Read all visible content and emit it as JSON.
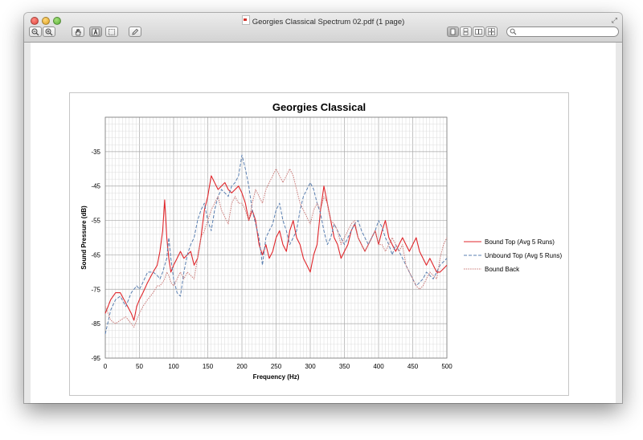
{
  "window": {
    "title": "Georgies Classical Spectrum 02.pdf (1 page)"
  },
  "toolbar": {
    "buttons": [
      "zoom-out-icon",
      "zoom-in-icon",
      "hand-tool-icon",
      "text-select-icon",
      "select-rect-icon",
      "annotate-pencil-icon"
    ],
    "view_buttons": [
      "single-page-icon",
      "continuous-icon",
      "two-page-icon",
      "two-up-continuous-icon"
    ],
    "search_placeholder": ""
  },
  "chart_data": {
    "type": "line",
    "title": "Georgies Classical",
    "xlabel": "Frequency (Hz)",
    "ylabel": "Sound Pressure (dB)",
    "xlim": [
      0,
      500
    ],
    "ylim": [
      -95,
      -25
    ],
    "xticks": [
      "0",
      "50",
      "100",
      "150",
      "200",
      "250",
      "300",
      "350",
      "400",
      "450",
      "500"
    ],
    "yticks": [
      "-35",
      "-45",
      "-55",
      "-65",
      "-75",
      "-85",
      "-95"
    ],
    "grid": true,
    "legend_position": "right",
    "series": [
      {
        "name": "Bound Top (Avg 5 Runs)",
        "color": "#e0262b",
        "dash": "solid",
        "x": [
          0,
          8,
          15,
          22,
          30,
          38,
          42,
          46,
          50,
          55,
          62,
          70,
          76,
          80,
          84,
          87,
          90,
          93,
          96,
          100,
          105,
          110,
          115,
          120,
          125,
          130,
          135,
          140,
          145,
          150,
          155,
          160,
          165,
          170,
          175,
          180,
          185,
          190,
          195,
          200,
          205,
          210,
          215,
          220,
          225,
          230,
          235,
          240,
          245,
          250,
          255,
          260,
          265,
          270,
          275,
          280,
          285,
          290,
          295,
          300,
          305,
          310,
          315,
          320,
          325,
          330,
          335,
          340,
          345,
          350,
          355,
          360,
          365,
          370,
          375,
          380,
          385,
          390,
          395,
          400,
          405,
          410,
          415,
          420,
          425,
          430,
          435,
          440,
          445,
          450,
          455,
          460,
          465,
          470,
          475,
          480,
          485,
          490,
          495,
          500
        ],
        "y": [
          -82,
          -78,
          -76,
          -76,
          -79,
          -82,
          -84,
          -80,
          -78,
          -76,
          -73,
          -70,
          -68,
          -64,
          -58,
          -49,
          -60,
          -66,
          -70,
          -68,
          -66,
          -64,
          -66,
          -65,
          -64,
          -68,
          -66,
          -60,
          -52,
          -48,
          -42,
          -44,
          -46,
          -45,
          -44,
          -46,
          -47,
          -46,
          -45,
          -47,
          -50,
          -55,
          -52,
          -55,
          -62,
          -65,
          -62,
          -66,
          -64,
          -60,
          -58,
          -62,
          -64,
          -58,
          -55,
          -60,
          -62,
          -66,
          -68,
          -70,
          -65,
          -62,
          -52,
          -45,
          -50,
          -55,
          -60,
          -62,
          -66,
          -64,
          -62,
          -58,
          -56,
          -60,
          -62,
          -64,
          -62,
          -60,
          -58,
          -62,
          -58,
          -55,
          -60,
          -62,
          -64,
          -62,
          -60,
          -62,
          -64,
          -62,
          -60,
          -64,
          -66,
          -68,
          -66,
          -68,
          -70,
          -70,
          -69,
          -68
        ]
      },
      {
        "name": "Unbound Top (Avg 5 Runs)",
        "color": "#5a7fb0",
        "dash": "dashed",
        "x": [
          0,
          8,
          15,
          22,
          30,
          38,
          42,
          46,
          50,
          55,
          62,
          70,
          76,
          80,
          84,
          87,
          90,
          93,
          96,
          100,
          105,
          110,
          115,
          120,
          125,
          130,
          135,
          140,
          145,
          150,
          155,
          160,
          165,
          170,
          175,
          180,
          185,
          190,
          195,
          200,
          205,
          210,
          215,
          220,
          225,
          230,
          235,
          240,
          245,
          250,
          255,
          260,
          265,
          270,
          275,
          280,
          285,
          290,
          295,
          300,
          305,
          310,
          315,
          320,
          325,
          330,
          335,
          340,
          345,
          350,
          355,
          360,
          365,
          370,
          375,
          380,
          385,
          390,
          395,
          400,
          405,
          410,
          415,
          420,
          425,
          430,
          435,
          440,
          445,
          450,
          455,
          460,
          465,
          470,
          475,
          480,
          485,
          490,
          495,
          500
        ],
        "y": [
          -88,
          -81,
          -78,
          -77,
          -80,
          -76,
          -75,
          -74,
          -75,
          -73,
          -70,
          -70,
          -71,
          -72,
          -70,
          -68,
          -66,
          -60,
          -66,
          -72,
          -76,
          -77,
          -70,
          -65,
          -62,
          -60,
          -55,
          -52,
          -50,
          -55,
          -58,
          -52,
          -48,
          -46,
          -47,
          -48,
          -45,
          -44,
          -42,
          -36,
          -40,
          -45,
          -52,
          -56,
          -60,
          -68,
          -60,
          -58,
          -56,
          -52,
          -50,
          -55,
          -58,
          -62,
          -60,
          -58,
          -52,
          -48,
          -46,
          -44,
          -46,
          -50,
          -53,
          -58,
          -62,
          -60,
          -56,
          -58,
          -60,
          -62,
          -60,
          -58,
          -56,
          -55,
          -58,
          -60,
          -62,
          -60,
          -58,
          -55,
          -57,
          -60,
          -62,
          -65,
          -62,
          -64,
          -66,
          -68,
          -70,
          -72,
          -74,
          -73,
          -72,
          -70,
          -71,
          -72,
          -70,
          -68,
          -67,
          -66
        ]
      },
      {
        "name": "Bound Back",
        "color": "#c97876",
        "dash": "dotted",
        "x": [
          0,
          8,
          15,
          22,
          30,
          38,
          42,
          46,
          50,
          55,
          62,
          70,
          76,
          80,
          84,
          87,
          90,
          93,
          96,
          100,
          105,
          110,
          115,
          120,
          125,
          130,
          135,
          140,
          145,
          150,
          155,
          160,
          165,
          170,
          175,
          180,
          185,
          190,
          195,
          200,
          205,
          210,
          215,
          220,
          225,
          230,
          235,
          240,
          245,
          250,
          255,
          260,
          265,
          270,
          275,
          280,
          285,
          290,
          295,
          300,
          305,
          310,
          315,
          320,
          325,
          330,
          335,
          340,
          345,
          350,
          355,
          360,
          365,
          370,
          375,
          380,
          385,
          390,
          395,
          400,
          405,
          410,
          415,
          420,
          425,
          430,
          435,
          440,
          445,
          450,
          455,
          460,
          465,
          470,
          475,
          480,
          485,
          490,
          495,
          500
        ],
        "y": [
          -80,
          -84,
          -85,
          -84,
          -83,
          -85,
          -86,
          -84,
          -82,
          -80,
          -78,
          -76,
          -74,
          -74,
          -73,
          -72,
          -70,
          -71,
          -73,
          -74,
          -72,
          -70,
          -72,
          -70,
          -71,
          -72,
          -66,
          -60,
          -58,
          -55,
          -52,
          -50,
          -48,
          -52,
          -54,
          -56,
          -50,
          -48,
          -50,
          -50,
          -52,
          -55,
          -50,
          -46,
          -48,
          -50,
          -46,
          -44,
          -42,
          -40,
          -42,
          -44,
          -42,
          -40,
          -42,
          -46,
          -50,
          -52,
          -54,
          -56,
          -52,
          -50,
          -52,
          -48,
          -50,
          -55,
          -56,
          -58,
          -62,
          -60,
          -58,
          -56,
          -55,
          -60,
          -62,
          -64,
          -62,
          -60,
          -58,
          -62,
          -62,
          -64,
          -62,
          -60,
          -62,
          -64,
          -62,
          -68,
          -70,
          -72,
          -74,
          -75,
          -74,
          -72,
          -70,
          -71,
          -72,
          -66,
          -62,
          -60
        ]
      }
    ]
  }
}
